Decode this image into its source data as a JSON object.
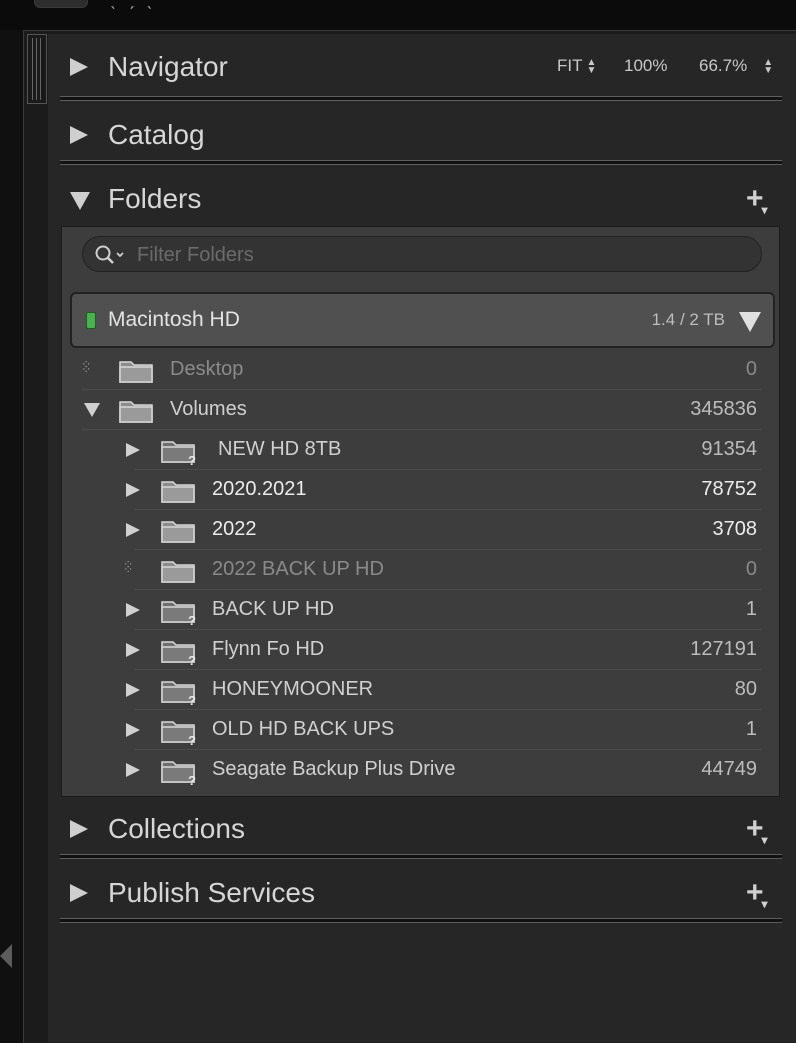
{
  "navigator": {
    "title": "Navigator",
    "zoom_fit": "FIT",
    "zoom_100": "100%",
    "zoom_custom": "66.7%"
  },
  "catalog": {
    "title": "Catalog"
  },
  "folders": {
    "title": "Folders",
    "add_label": "+",
    "filter_placeholder": "Filter Folders",
    "volume": {
      "name": "Macintosh HD",
      "usage": "1.4 / 2 TB",
      "status_color": "#4caf50"
    },
    "items": [
      {
        "name": "Desktop",
        "count": "0"
      },
      {
        "name": "Volumes",
        "count": "345836"
      },
      {
        "name": "NEW HD 8TB",
        "count": "91354"
      },
      {
        "name": "2020.2021",
        "count": "78752"
      },
      {
        "name": "2022",
        "count": "3708"
      },
      {
        "name": "2022 BACK UP HD",
        "count": "0"
      },
      {
        "name": "BACK UP HD",
        "count": "1"
      },
      {
        "name": "Flynn Fo HD",
        "count": "127191"
      },
      {
        "name": "HONEYMOONER",
        "count": "80"
      },
      {
        "name": "OLD HD BACK UPS",
        "count": "1"
      },
      {
        "name": "Seagate Backup Plus Drive",
        "count": "44749"
      }
    ]
  },
  "collections": {
    "title": "Collections",
    "add_label": "+"
  },
  "publish_services": {
    "title": "Publish Services",
    "add_label": "+"
  },
  "icons": {
    "expand": "triangle-right-icon",
    "collapse": "triangle-down-icon",
    "folder": "folder-icon",
    "missing_folder": "folder-missing-icon",
    "search": "search-icon"
  }
}
